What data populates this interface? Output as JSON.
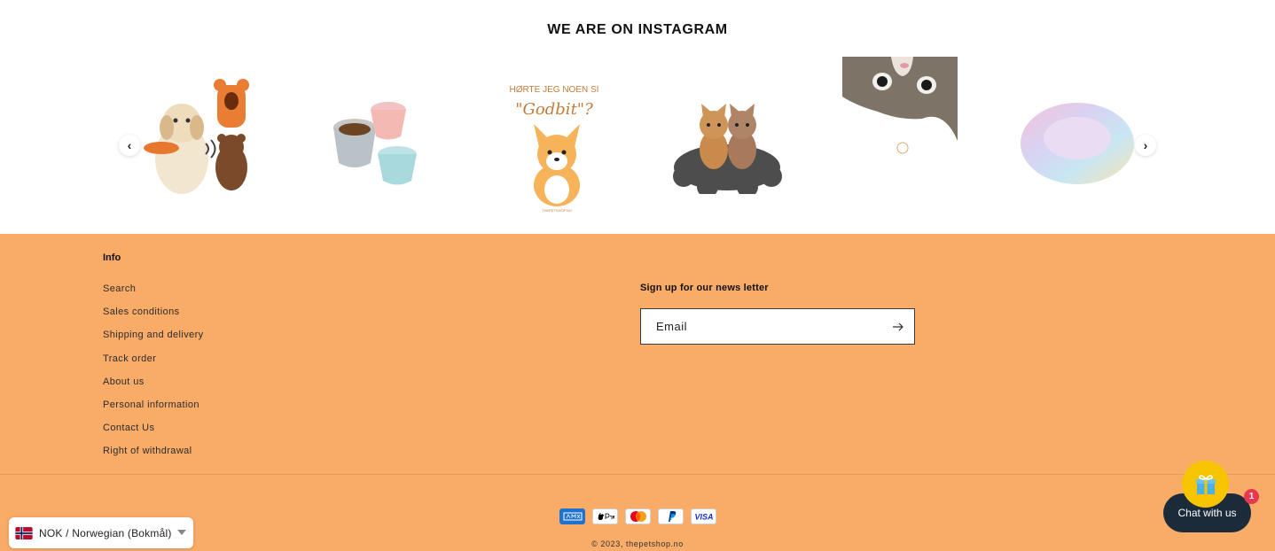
{
  "instagram": {
    "title": "WE ARE ON INSTAGRAM",
    "prev_icon": "chevron-left-icon",
    "next_icon": "chevron-right-icon",
    "prev_glyph": "‹",
    "next_glyph": "›",
    "slides": [
      {
        "name": "dog-with-plush-toys-image"
      },
      {
        "name": "pet-food-bowls-image"
      },
      {
        "name": "godbit-puppy-image",
        "text_line1": "HØRTE JEG NOEN SI",
        "text_line2": "\"Godbit\"?",
        "credit": "THEPETSHOP.NO"
      },
      {
        "name": "kittens-on-paw-mat-image"
      },
      {
        "name": "cat-peeking-image"
      },
      {
        "name": "fluffy-pet-bed-image"
      }
    ]
  },
  "footer": {
    "info_heading": "Info",
    "info_links": [
      "Search",
      "Sales conditions",
      "Shipping and delivery",
      "Track order",
      "About us",
      "Personal information",
      "Contact Us",
      "Right of withdrawal"
    ],
    "newsletter_heading": "Sign up for our news letter",
    "email_placeholder": "Email",
    "submit_icon": "arrow-right-icon",
    "payment_methods": [
      "American Express",
      "Apple Pay",
      "Mastercard",
      "PayPal",
      "Visa"
    ],
    "copyright": "© 2023, thepetshop.no"
  },
  "currency_selector": {
    "label": "NOK / Norwegian (Bokmål)",
    "flag_icon": "norway-flag-icon"
  },
  "chat": {
    "label": "Chat with us",
    "badge_count": "1",
    "gift_icon": "gift-icon"
  },
  "colors": {
    "footer_background": "#f9ab68",
    "chat_background": "#1c2b3a",
    "gift_background": "#f7c400",
    "badge_background": "#e8384f"
  }
}
